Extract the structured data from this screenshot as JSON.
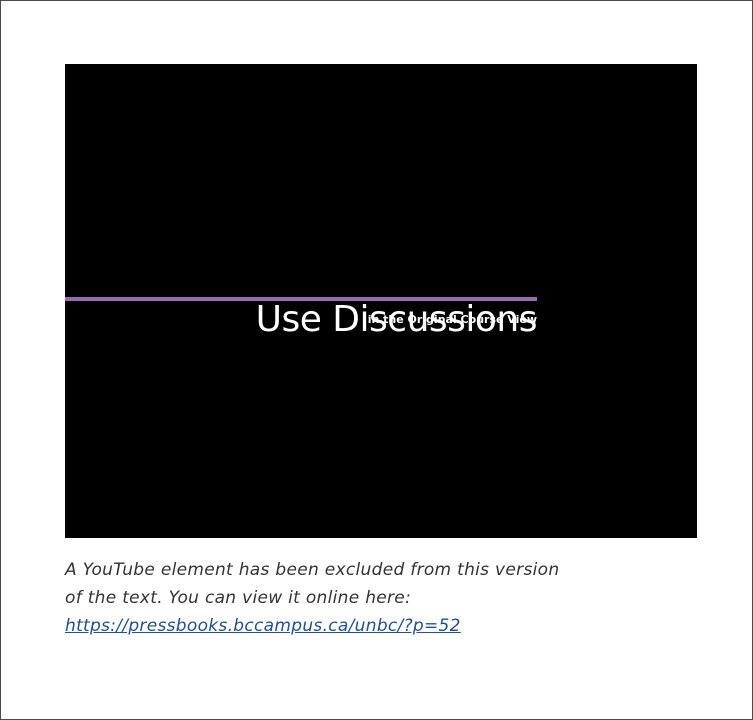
{
  "video": {
    "title": "Use Discussions",
    "subtitle": "in the Original Course View",
    "accent_color": "#9b6ab6",
    "background_color": "#000000"
  },
  "caption": {
    "line_1": "A YouTube element has been excluded from this version",
    "line_2": "of the text. You can view it online here:",
    "link_text": "https://pressbooks.bccampus.ca/unbc/?p=52",
    "link_color": "#1d4f9a"
  }
}
